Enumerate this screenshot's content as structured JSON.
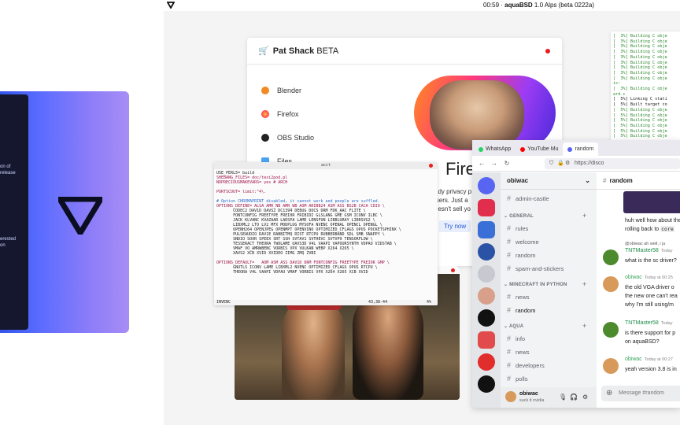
{
  "menubar": {
    "clock": "00:59 · ",
    "app_name": "aquaBSD",
    "version": " 1.0 Alps (beta 0222a)"
  },
  "left_panel": {
    "line1": "on of",
    "line2": "release",
    "line3": "erested",
    "line4": "on"
  },
  "patshack": {
    "title": "Pat Shack",
    "badge": "BETA",
    "apps": [
      "Blender",
      "Firefox",
      "OBS Studio",
      "Files"
    ],
    "hero_heading": "Fire",
    "hero_text": "ady privacy p\nisers. Just a\noesn't sell yo",
    "try_label": "Try now"
  },
  "terminal": {
    "title": "acct",
    "lines": [
      "USE_PERL5= build",
      "SHEBANG_FILES= doc/texi2pod.pl",
      "NOPRECIOUSMAKEVARS= yes # ARCH",
      "",
      "PORTSCOUT= limit:^4\\.",
      "",
      "# Option CHROMAPRINT disabled, it cannot work and people are suffled.",
      "OPTIONS_DEFINE= ALSA AMR_NB AMR_WB AOM ARIBB24 ASM ASS BS2B CACA CDIO \\",
      "       CODEC2 DAV1D DAVS2 DC1394 DEBUG DOCS DRM FDK_AAC FLITE \\",
      "       FONTCONFIG FREETYPE FREI0R FRIBIDI GLSLANG GME GSM ICONV ILBC \\",
      "       JACK KLVANC KVAZAAR LADSPA LAME LENSFUN LIBBLURAY LIBRSVG2 \\",
      "       LIBXML2 LTO LV2 MFX MODPLUG MYSOFA NVENC OPENAL OPENCL OPENGL \\",
      "       OPENH264 OPENJPEG OPENMPT OPENVINO OPTIMIZED_CFLAGS OPUS POCKETSPHINX \\",
      "       PULSEAUDIO RAV1E RABBITMQ RIST RTCPU RUBBERBAND SDL SMB SNAPPY \\",
      "       SNDIO SOXR SPEEX SRT SSH SVTAV1 SVTHEVC SVTVP9 TENSORFLOW \\",
      "       TESSERACT THEORA TWOLAME UAVS3D V4L VAAPI VAPOURSYNTH VDPAU VIDSTAB \\",
      "       VMAF VO_AMRWBENC VORBIS VPX VULKAN WEBP X264 X265 \\",
      "       XAVS2 XCB XVID XVIDEO ZIMG ZMQ ZVBI",
      "",
      "OPTIONS_DEFAULT=   AOM ASM ASS DAV1D DRM FONTCONFIG FREETYPE FREI0R GMP \\",
      "       GNUTLS ICONV LAME LIBXML2 NVENC OPTIMIZED_CFLAGS OPUS RTCPU \\",
      "       THEORA V4L VAAPI VDPAU VMAF VORBIS VPX X264 X265 XCB XVID"
    ],
    "status_mode": "INVENC",
    "status_pos": "43,38-44",
    "status_pct": "4%"
  },
  "buildlog": {
    "lines": [
      "[  3%] Building C obje",
      "[  3%] Building C obje",
      "[  3%] Building C obje",
      "[  3%] Building C obje",
      "[  3%] Building C obje",
      "[  3%] Building C obje",
      "[  3%] Building C obje",
      "[  3%] Building C obje",
      "[  3%] Building C obje",
      "ic:",
      "[  3%] Building C obje",
      "ard.c",
      "[  5%] Linking C stati",
      "[  5%] Built target co",
      "[  5%] Building C obje",
      "[  5%] Building C obje",
      "[  5%] Building C obje",
      "[  5%] Building C obje",
      "[  5%] Building C obje",
      "[  5%] Building C obje",
      "",
      "[  7%] Building C obje",
      "[  7%] Building C obje",
      "[  7%] Building C obje",
      "[  7%] Building C obje"
    ]
  },
  "browser": {
    "tabs": [
      "WhatsApp",
      "YouTube Mu",
      "random"
    ],
    "url": "https://disco"
  },
  "discord": {
    "server_name": "obiwac",
    "top_channel": "admin-castle",
    "categories": [
      {
        "name": "GENERAL",
        "channels": [
          "rules",
          "welcome",
          "random",
          "spam-and-stickers"
        ]
      },
      {
        "name": "MINECRAFT IN PYTHON",
        "channels": [
          "news",
          "random"
        ]
      },
      {
        "name": "AQUA",
        "channels": [
          "info",
          "news",
          "developers",
          "polls"
        ]
      }
    ],
    "user": {
      "name": "obiwac",
      "status": "suck it nvidia"
    },
    "chat_channel": "random",
    "messages": [
      {
        "lines": [
          "huh well how about the",
          "rolling back to "
        ],
        "code": "core"
      },
      {
        "reply": "@obiwac ah well, i ju",
        "author": "TNTMaster58",
        "time": "Today",
        "lines": [
          "what is the sc driver?"
        ]
      },
      {
        "author": "obiwac",
        "time": "Today at 00:25",
        "lines": [
          "the old VGA driver o",
          "the new one can't rea",
          "why I'm still using/m"
        ]
      },
      {
        "author": "TNTMaster58",
        "time": "Today",
        "lines": [
          "is there support for p",
          "on aquaBSD?"
        ]
      },
      {
        "author": "obiwac",
        "time": "Today at 00:27",
        "lines": [
          "yeah version 3.8 is in"
        ]
      }
    ],
    "composer_placeholder": "Message #random"
  },
  "colors": {
    "accent": "#5865f2",
    "tnt_name": "#1f8b4c",
    "obiwac_name": "#3aa55d",
    "close_dot": "#e81e1e"
  }
}
